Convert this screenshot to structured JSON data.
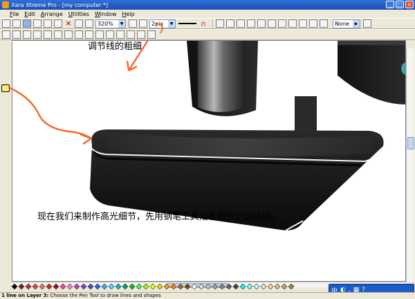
{
  "window": {
    "title": "Xara Xtreme Pro - [my computer *]",
    "buttons": [
      "_",
      "□",
      "×"
    ]
  },
  "menu": [
    "File",
    "Edit",
    "Arrange",
    "Utilities",
    "Window",
    "Help"
  ],
  "toolbar": {
    "zoom_value": "320%",
    "line_width_value": "2pix",
    "fill_value": "None"
  },
  "document": {
    "annotation_top": "调节线的粗细",
    "annotation_bottom": "现在我们来制作高光细节，先用钢笔工具沿着图形的边话线。"
  },
  "status": {
    "bold_part": "1 line on Layer 3:",
    "text": " Choose the Pen Tool to draw lines and shapes"
  },
  "ime": {
    "label": "中"
  },
  "colors": {
    "accent_annotation": "#f26b2a",
    "palette": [
      "#000000",
      "#7a1f0a",
      "#b0322a",
      "#e8403a",
      "#ff6a5a",
      "#c8281e",
      "#a8002a",
      "#ff3aa0",
      "#ff80c8",
      "#c040c0",
      "#8040c0",
      "#4040e0",
      "#2060ff",
      "#40a0ff",
      "#60d0ff",
      "#00c0c0",
      "#00a060",
      "#00c000",
      "#40ff40",
      "#a0ff00",
      "#ffff00",
      "#ffd000",
      "#ffa000",
      "#ff8000",
      "#c06000",
      "#804000",
      "#ffffff",
      "#e0e0e0",
      "#c0c0c0",
      "#a0a0a0",
      "#808080",
      "#606060",
      "#404040",
      "#00ffff",
      "#80ffff",
      "#c0ffff",
      "#ffe0c0",
      "#ffd0a0",
      "#e0c080",
      "#c0a060",
      "#a08040"
    ]
  }
}
